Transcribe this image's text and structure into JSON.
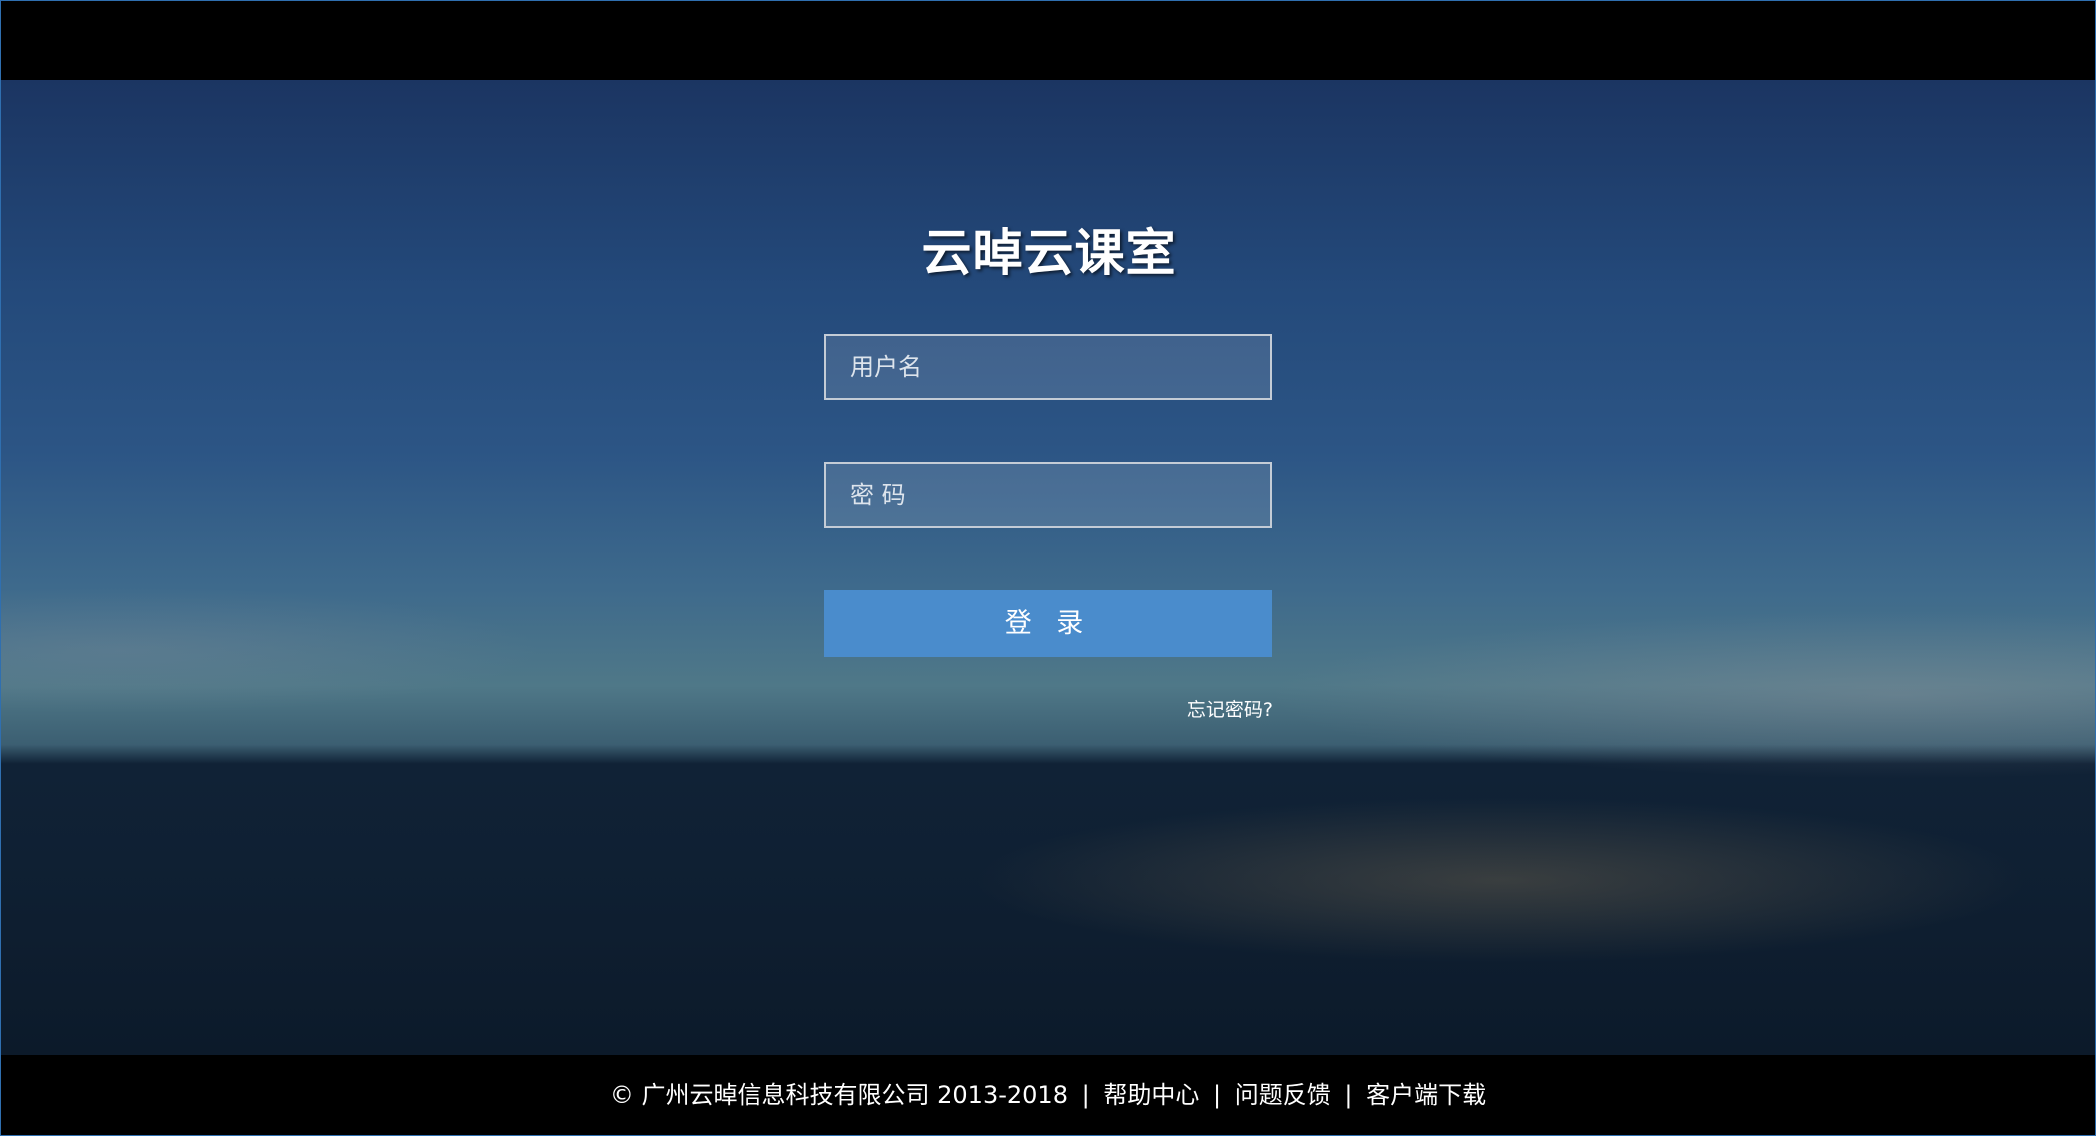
{
  "app": {
    "title": "云晫云课室"
  },
  "login_form": {
    "username_placeholder": "用户名",
    "password_placeholder": "密 码",
    "login_button_label": "登 录",
    "forgot_password_link": "忘记密码?"
  },
  "footer": {
    "copyright": "© 广州云晫信息科技有限公司 2013-2018",
    "separator": "|",
    "links": [
      "帮助中心",
      "问题反馈",
      "客户端下载"
    ]
  },
  "colors": {
    "login_button": "#4a8ccc",
    "frame_border": "#2f6fb0"
  }
}
